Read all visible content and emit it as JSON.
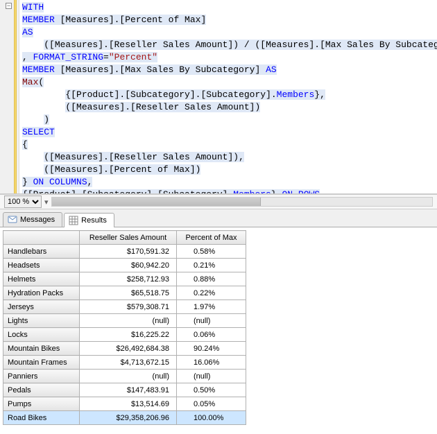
{
  "editor": {
    "code_html": "<span class=\"blk\"><span class=\"kw\">WITH</span></span>\n<span class=\"blk\"><span class=\"kw\">MEMBER</span> [Measures].[Percent of Max]</span>\n<span class=\"blk\"><span class=\"kw\">AS</span></span>\n    <span class=\"blk\">([Measures].[Reseller Sales Amount]) / ([Measures].[Max Sales By Subcategory])</span>\n<span class=\"blk\">, <span class=\"kw\">FORMAT_STRING</span>=<span class=\"str\">\"Percent\"</span></span>\n<span class=\"blk\"><span class=\"kw\">MEMBER</span> [Measures].[Max Sales By Subcategory] <span class=\"kw\">AS</span></span>\n<span class=\"blk\"><span class=\"fn\">Max</span>(</span>\n        <span class=\"blk\">{[Product].[Subcategory].[Subcategory].<span class=\"kw\">Members</span>},</span>\n        <span class=\"blk\">([Measures].[Reseller Sales Amount])</span>\n    <span class=\"blk\">)</span>\n<span class=\"blk\"><span class=\"kw\">SELECT</span></span>\n<span class=\"blk\">{</span>\n    <span class=\"blk\">([Measures].[Reseller Sales Amount]),</span>\n    <span class=\"blk\">([Measures].[Percent of Max])</span>\n<span class=\"blk\">} <span class=\"kw\">ON</span> <span class=\"kw\">COLUMNS</span>,</span>\n<span class=\"blk\">{[Product].[Subcategory].[Subcategory].<span class=\"kw\">Members</span>} <span class=\"kw\">ON</span> <span class=\"kw\">ROWS</span></span>\n<span class=\"blk\"><span class=\"kw\">FROM</span> [Step-by-Step]</span>"
  },
  "zoom": {
    "value": "100 %"
  },
  "tabs": {
    "messages": "Messages",
    "results": "Results"
  },
  "grid": {
    "columns": [
      "",
      "Reseller Sales Amount",
      "Percent of Max"
    ],
    "rows": [
      {
        "label": "Handlebars",
        "amount": "$170,591.32",
        "pct": "0.58%"
      },
      {
        "label": "Headsets",
        "amount": "$60,942.20",
        "pct": "0.21%"
      },
      {
        "label": "Helmets",
        "amount": "$258,712.93",
        "pct": "0.88%"
      },
      {
        "label": "Hydration Packs",
        "amount": "$65,518.75",
        "pct": "0.22%"
      },
      {
        "label": "Jerseys",
        "amount": "$579,308.71",
        "pct": "1.97%"
      },
      {
        "label": "Lights",
        "amount": "(null)",
        "pct": "(null)"
      },
      {
        "label": "Locks",
        "amount": "$16,225.22",
        "pct": "0.06%"
      },
      {
        "label": "Mountain Bikes",
        "amount": "$26,492,684.38",
        "pct": "90.24%"
      },
      {
        "label": "Mountain Frames",
        "amount": "$4,713,672.15",
        "pct": "16.06%"
      },
      {
        "label": "Panniers",
        "amount": "(null)",
        "pct": "(null)"
      },
      {
        "label": "Pedals",
        "amount": "$147,483.91",
        "pct": "0.50%"
      },
      {
        "label": "Pumps",
        "amount": "$13,514.69",
        "pct": "0.05%"
      },
      {
        "label": "Road Bikes",
        "amount": "$29,358,206.96",
        "pct": "100.00%",
        "selected": true
      }
    ]
  }
}
